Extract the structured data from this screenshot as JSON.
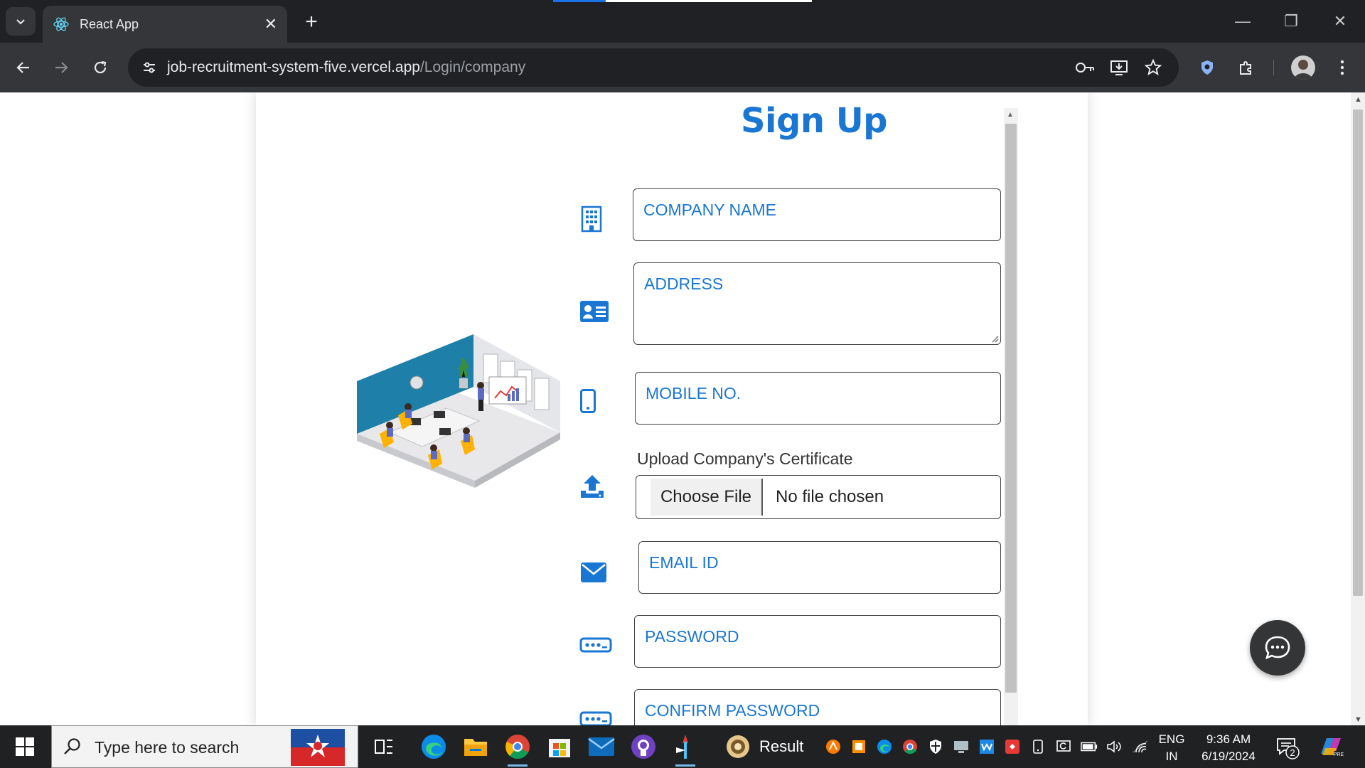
{
  "browser": {
    "tab_title": "React App",
    "url_host": "job-recruitment-system-five.vercel.app",
    "url_path": "/Login/company"
  },
  "form": {
    "title": "Sign Up",
    "company_name_label": "COMPANY NAME",
    "address_label": "ADDRESS",
    "mobile_label": "MOBILE NO.",
    "upload_label": "Upload Company's Certificate",
    "choose_file_label": "Choose File",
    "no_file_label": "No file chosen",
    "email_label": "EMAIL ID",
    "password_label": "PASSWORD",
    "confirm_password_label": "CONFIRM PASSWORD"
  },
  "taskbar": {
    "search_placeholder": "Type here to search",
    "result_app_label": "Result",
    "language_line1": "ENG",
    "language_line2": "IN",
    "time": "9:36 AM",
    "date": "6/19/2024",
    "notification_count": "2"
  },
  "colors": {
    "accent": "#1976d2",
    "tabbar": "#202124",
    "toolbar": "#35363a",
    "taskbar": "#1f2123"
  }
}
